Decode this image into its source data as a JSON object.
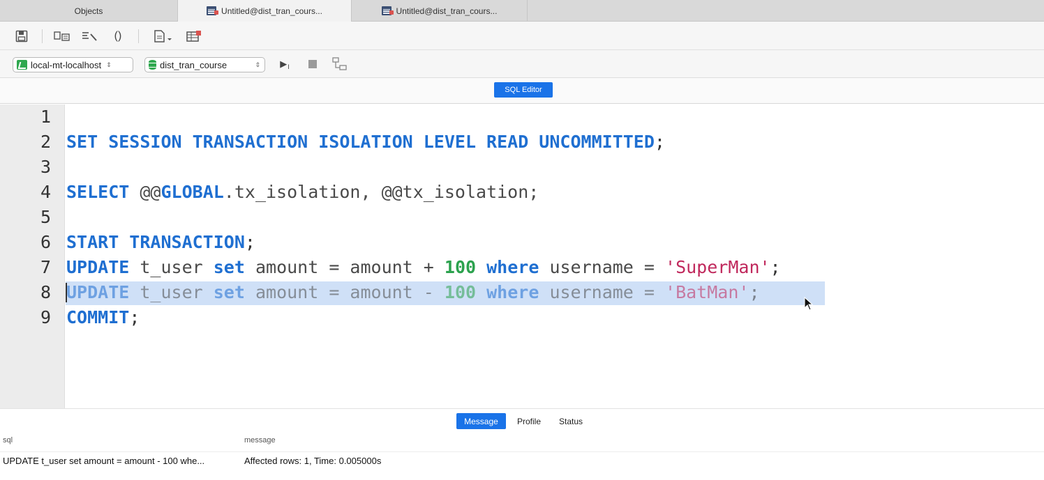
{
  "tabs": {
    "objects": "Objects",
    "query1": "Untitled@dist_tran_cours...",
    "query2": "Untitled@dist_tran_cours..."
  },
  "toolbar": {
    "icons": [
      "save-icon",
      "format-icon",
      "beautify-icon",
      "parentheses-icon",
      "snippet-icon",
      "table-icon"
    ],
    "parentheses_label": "()"
  },
  "connection": {
    "server": "local-mt-localhost",
    "database": "dist_tran_course",
    "run_glyph": "▶",
    "run_sub": "I"
  },
  "mode": {
    "sql_editor": "SQL Editor"
  },
  "editor": {
    "line_numbers": [
      "1",
      "2",
      "3",
      "4",
      "5",
      "6",
      "7",
      "8",
      "9"
    ],
    "selected_line": 8
  },
  "results": {
    "tabs": [
      "Message",
      "Profile",
      "Status"
    ],
    "active_tab": "Message",
    "columns": [
      "sql",
      "message"
    ],
    "rows": [
      [
        "UPDATE t_user set amount = amount - 100 whe...",
        "Affected rows: 1, Time: 0.005000s"
      ]
    ]
  },
  "colors": {
    "keyword": "#1f6fd1",
    "number": "#2ca24e",
    "string": "#c0285c",
    "accent": "#1a73e8",
    "selection": "#cfe0f7"
  }
}
